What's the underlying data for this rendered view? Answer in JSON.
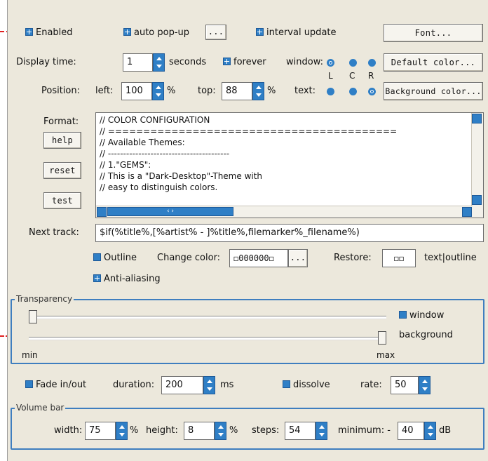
{
  "top": {
    "enabled": "Enabled",
    "auto_popup": "auto pop-up",
    "ellipsis": "...",
    "interval_update": "interval update",
    "font_button": "Font..."
  },
  "display": {
    "label": "Display time:",
    "value": "1",
    "unit": "seconds",
    "forever": "forever",
    "window_label": "window:",
    "lcr": [
      "L",
      "C",
      "R"
    ],
    "default_color_button": "Default color..."
  },
  "position": {
    "label": "Position:",
    "left_label": "left:",
    "left_value": "100",
    "left_unit": "%",
    "top_label": "top:",
    "top_value": "88",
    "top_unit": "%",
    "text_label": "text:",
    "background_color_button": "Background color..."
  },
  "format": {
    "label": "Format:",
    "help_button": "help",
    "reset_button": "reset",
    "test_button": "test",
    "lines": [
      "// COLOR CONFIGURATION",
      "// =========================================",
      "// Available Themes:",
      "// ----------------------------------------",
      "// 1.\"GEMS\":",
      "// This is a \"Dark-Desktop\"-Theme with",
      "// easy to distinguish colors."
    ],
    "hscroll_grip": "‹ ›"
  },
  "next_track": {
    "label": "Next track:",
    "value": "$if(%title%,[%artist% - ]%title%,filemarker%_filename%)"
  },
  "outline": {
    "outline_label": "Outline",
    "change_color_label": "Change color:",
    "color_value": "◻000000◻",
    "ellipsis": "...",
    "restore_label": "Restore:",
    "restore_value": "◻◻",
    "restore_suffix": "text|outline",
    "anti_aliasing": "Anti-aliasing"
  },
  "transparency": {
    "title": "Transparency",
    "window_label": "window",
    "background_label": "background",
    "min_label": "min",
    "max_label": "max",
    "window_level": 0.0,
    "background_level": 1.0
  },
  "fade": {
    "fade_label": "Fade in/out",
    "duration_label": "duration:",
    "duration_value": "200",
    "duration_unit": "ms",
    "dissolve_label": "dissolve",
    "rate_label": "rate:",
    "rate_value": "50"
  },
  "volume": {
    "title": "Volume bar",
    "width_label": "width:",
    "width_value": "75",
    "width_unit": "%",
    "height_label": "height:",
    "height_value": "8",
    "height_unit": "%",
    "steps_label": "steps:",
    "steps_value": "54",
    "minimum_label": "minimum: -",
    "minimum_value": "40",
    "minimum_unit": "dB"
  },
  "colors": {
    "accent": "#2f7fc6",
    "panel": "#ece8dc",
    "arrow": "#e02020"
  }
}
